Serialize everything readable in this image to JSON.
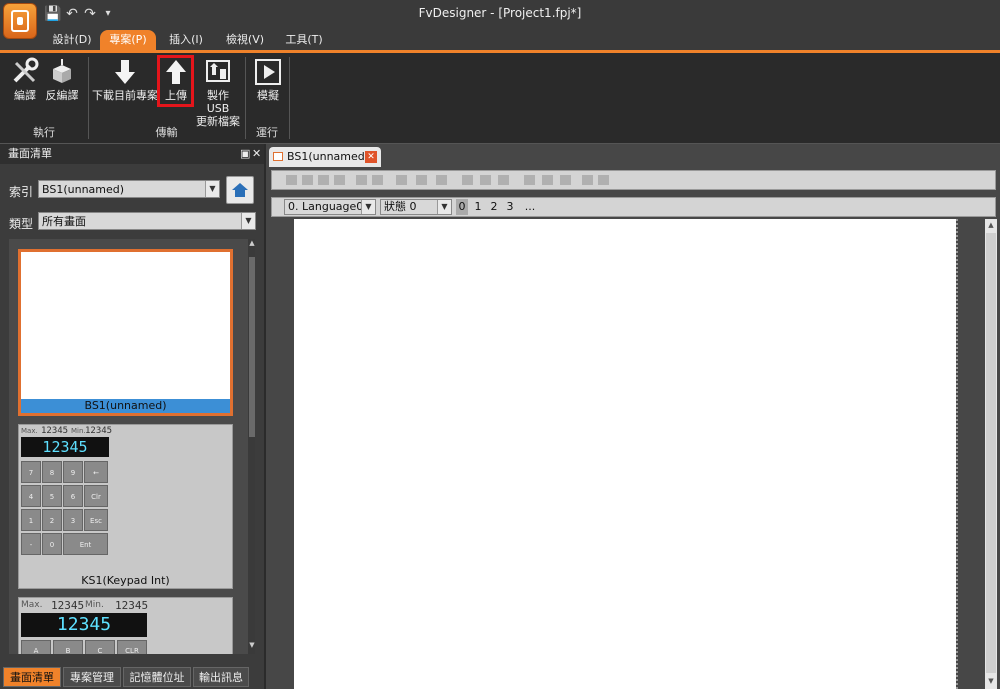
{
  "window": {
    "title": "FvDesigner - [Project1.fpj*]"
  },
  "menu_tabs": [
    {
      "label": "設計(D)"
    },
    {
      "label": "專案(P)"
    },
    {
      "label": "插入(I)"
    },
    {
      "label": "檢視(V)"
    },
    {
      "label": "工具(T)"
    }
  ],
  "ribbon": {
    "groups": [
      {
        "label": "執行"
      },
      {
        "label": "傳輸"
      },
      {
        "label": "運行"
      }
    ],
    "buttons": {
      "compile": "編譯",
      "decompile": "反編譯",
      "download": "下載目前專案",
      "upload": "上傳",
      "usb_line1": "製作 USB",
      "usb_line2": "更新檔案",
      "simulate": "模擬"
    }
  },
  "left_panel": {
    "title": "畫面清單",
    "index_label": "索引",
    "index_value": "BS1(unnamed)",
    "type_label": "類型",
    "type_value": "所有畫面",
    "thumbnails": [
      {
        "caption": "BS1(unnamed)"
      },
      {
        "caption": "KS1(Keypad Int)"
      }
    ],
    "keypad1": {
      "max_label": "Max.",
      "max_value": "12345",
      "min_label": "Min.",
      "min_value": "12345",
      "display": "12345",
      "keys": [
        "7",
        "8",
        "9",
        "←",
        "4",
        "5",
        "6",
        "Clr",
        "1",
        "2",
        "3",
        "Esc",
        "-",
        "0",
        "Ent"
      ]
    },
    "keypad2": {
      "max_label": "Max.",
      "max_value": "12345",
      "min_label": "Min.",
      "min_value": "12345",
      "display": "12345",
      "keys": [
        "A",
        "B",
        "C",
        "CLR"
      ]
    },
    "bottom_tabs": [
      {
        "label": "畫面清單"
      },
      {
        "label": "專案管理"
      },
      {
        "label": "記憶體位址"
      },
      {
        "label": "輸出訊息"
      }
    ]
  },
  "editor": {
    "doc_tab": "BS1(unnamed)",
    "language": "0.  Language0",
    "state": "狀態 0",
    "state_numbers": [
      "0",
      "1",
      "2",
      "3"
    ],
    "more": "..."
  },
  "colors": {
    "accent": "#f0822a",
    "highlight": "#e4151b",
    "selected_caption": "#3c8fd6"
  }
}
